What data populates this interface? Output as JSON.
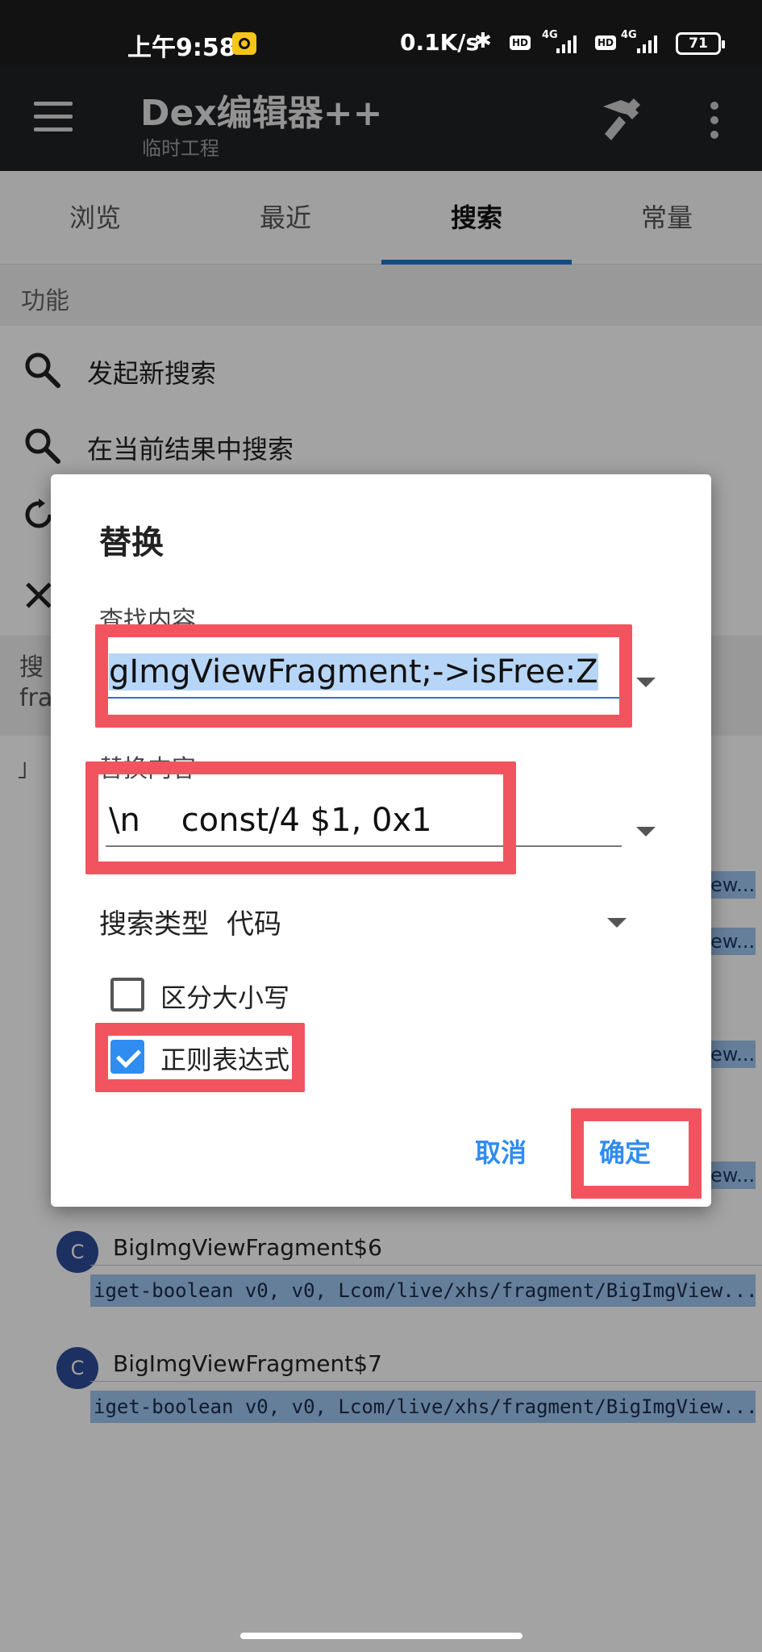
{
  "status_bar": {
    "time": "上午9:58",
    "network_speed": "0.1K/s",
    "hd_label": "HD",
    "network_type": "4G",
    "battery": "71"
  },
  "app_bar": {
    "title": "Dex编辑器++",
    "subtitle": "临时工程",
    "icons": [
      "menu-icon",
      "hammer-icon",
      "more-vert-icon"
    ]
  },
  "tabs": [
    {
      "label": "浏览",
      "active": false
    },
    {
      "label": "最近",
      "active": false
    },
    {
      "label": "搜索",
      "active": true
    },
    {
      "label": "常量",
      "active": false
    }
  ],
  "background": {
    "section_header": "功能",
    "functions": [
      {
        "label": "发起新搜索",
        "icon": "search-icon"
      },
      {
        "label": "在当前结果中搜索",
        "icon": "search-icon"
      }
    ],
    "partial_labels": [
      "搜",
      "fra",
      "˩"
    ],
    "highlight_fragment": "ew...",
    "results": [
      {
        "class_name": "BigImgViewFragment$6",
        "icon_letter": "C",
        "code": "iget-boolean v0, v0, Lcom/live/xhs/fragment/BigImgView..."
      },
      {
        "class_name": "BigImgViewFragment$7",
        "icon_letter": "C",
        "code": "iget-boolean v0, v0, Lcom/live/xhs/fragment/BigImgView..."
      }
    ]
  },
  "dialog": {
    "title": "替换",
    "find_label": "查找内容",
    "find_value": "gImgViewFragment;->isFree:Z",
    "replace_label": "替换内容",
    "replace_value": "\\n    const/4 $1, 0x1",
    "search_type_label": "搜索类型",
    "search_type_value": "代码",
    "options": [
      {
        "label": "区分大小写",
        "checked": false
      },
      {
        "label": "正则表达式",
        "checked": true
      }
    ],
    "cancel_label": "取消",
    "confirm_label": "确定"
  },
  "colors": {
    "accent": "#2f8cf0",
    "tab_indicator": "#1976d2",
    "annotation_red": "#f2545f",
    "app_bar": "#202124",
    "highlight": "#9ec6ef"
  }
}
